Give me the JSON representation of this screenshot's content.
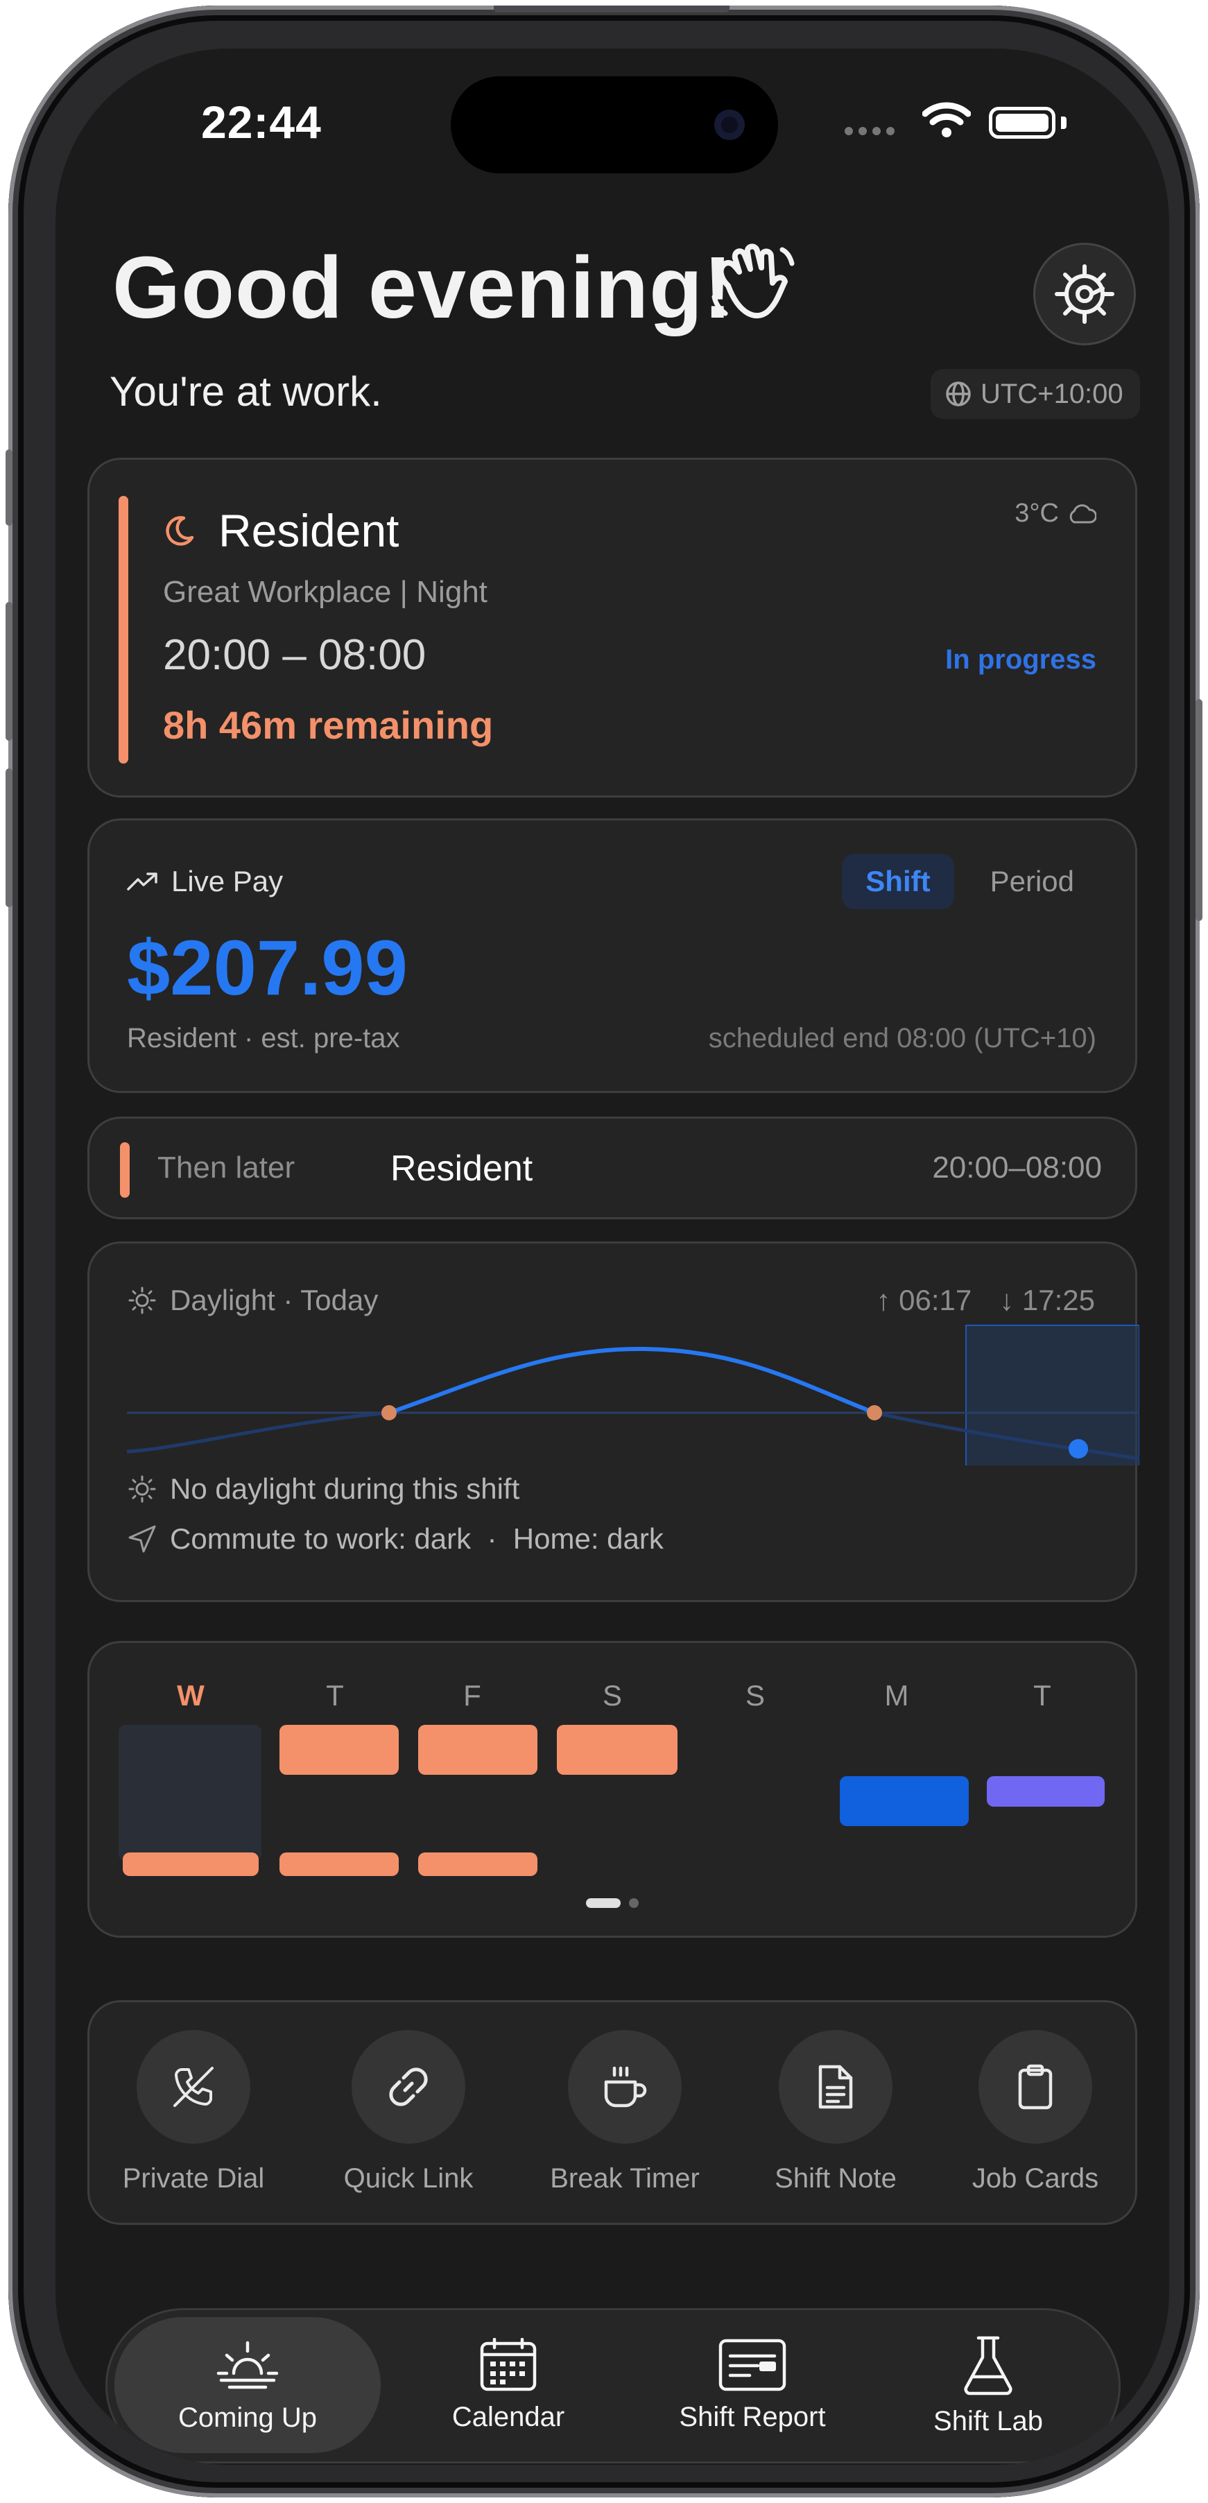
{
  "status_bar": {
    "time": "22:44"
  },
  "header": {
    "greeting": "Good evening!",
    "subtitle": "You're at work.",
    "timezone": "UTC+10:00"
  },
  "current_shift": {
    "title": "Resident",
    "workplace": "Great Workplace | Night",
    "hours": "20:00 – 08:00",
    "status": "In progress",
    "remaining": "8h 46m remaining",
    "weather": "3°C",
    "accent_color": "#f4916a"
  },
  "live_pay": {
    "label": "Live Pay",
    "amount": "$207.99",
    "segments": [
      "Shift",
      "Period"
    ],
    "selected_segment": "Shift",
    "subtitle": "Resident · est. pre-tax",
    "end_note": "scheduled end 08:00 (UTC+10)"
  },
  "later": {
    "label": "Then later",
    "title": "Resident",
    "hours": "20:00–08:00"
  },
  "daylight": {
    "title": "Daylight · Today",
    "sunrise": "06:17",
    "sunset": "17:25",
    "note": "No daylight during this shift",
    "commute": "Commute to work: dark  ·  Home: dark"
  },
  "week": {
    "days": [
      "W",
      "T",
      "F",
      "S",
      "S",
      "M",
      "T"
    ],
    "today_index": 0,
    "page_count": 2,
    "current_page": 0
  },
  "quick_actions": [
    {
      "label": "Private Dial",
      "icon": "phone-off-icon"
    },
    {
      "label": "Quick Link",
      "icon": "link-icon"
    },
    {
      "label": "Break Timer",
      "icon": "coffee-icon"
    },
    {
      "label": "Shift Note",
      "icon": "note-icon"
    },
    {
      "label": "Job Cards",
      "icon": "clipboard-icon"
    }
  ],
  "tabs": [
    {
      "label": "Coming Up",
      "icon": "sunrise-icon"
    },
    {
      "label": "Calendar",
      "icon": "calendar-icon"
    },
    {
      "label": "Shift Report",
      "icon": "report-icon"
    },
    {
      "label": "Shift Lab",
      "icon": "flask-icon"
    }
  ],
  "selected_tab": "Coming Up",
  "colors": {
    "accent_orange": "#f4916a",
    "accent_blue": "#2678f2",
    "accent_purple": "#7068f2",
    "background": "#1b1b1b",
    "card": "#242424"
  }
}
